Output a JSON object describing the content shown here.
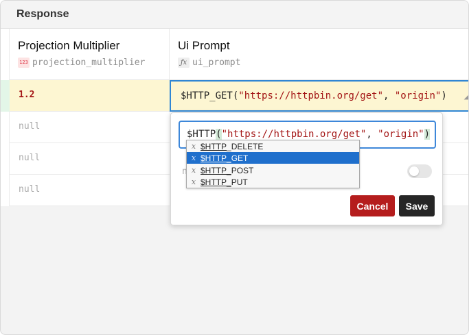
{
  "header": {
    "title": "Response"
  },
  "columns": [
    {
      "title": "Projection Multiplier",
      "field": "projection_multiplier",
      "type_icon": "123"
    },
    {
      "title": "Ui Prompt",
      "field": "ui_prompt",
      "type_icon": "fx"
    }
  ],
  "rows": [
    {
      "projection_multiplier": "1.2"
    },
    {
      "projection_multiplier": "null"
    },
    {
      "projection_multiplier": "null"
    },
    {
      "projection_multiplier": "null"
    }
  ],
  "editing_cell": {
    "fn": "$HTTP_GET(",
    "arg1": "\"https://httpbin.org/get\"",
    "sep": ", ",
    "arg2": "\"origin\"",
    "close": ")"
  },
  "editor": {
    "fn": "$HTTP",
    "open": "(",
    "arg1": "\"https://httpbin.org/get\"",
    "sep": ", ",
    "arg2": "\"origin\"",
    "close": ")",
    "hidden_char": "n"
  },
  "autocomplete": {
    "prefix": "$HTTP",
    "items": [
      {
        "match": "$HTTP",
        "rest": "_DELETE",
        "selected": false
      },
      {
        "match": "$HTTP_",
        "rest": "GET",
        "selected": true
      },
      {
        "match": "$HTTP_",
        "rest": "POST",
        "selected": false
      },
      {
        "match": "$HTTP_",
        "rest": "PUT",
        "selected": false
      }
    ],
    "kind_glyph": "x"
  },
  "toggle": {
    "on": false
  },
  "buttons": {
    "cancel": "Cancel",
    "save": "Save"
  },
  "colors": {
    "cancel": "#b51d1d",
    "save": "#262626",
    "focus": "#2f86d4",
    "active_row": "#fdf6d2",
    "selected_item": "#1f6fcc"
  }
}
